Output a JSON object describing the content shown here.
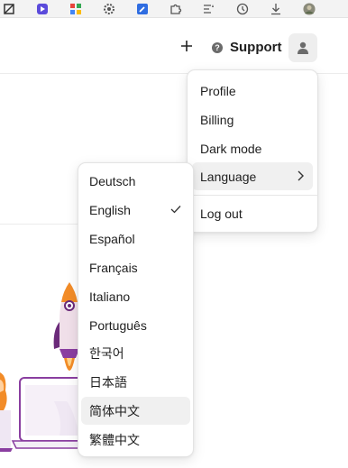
{
  "extensions": [
    {
      "name": "ext-app-icon",
      "color": "#333333"
    },
    {
      "name": "ext-purple-icon",
      "color": "#5b4bdb"
    },
    {
      "name": "ext-tiles-icon",
      "color": "#e8453c"
    },
    {
      "name": "ext-gear-icon",
      "color": "#555555"
    },
    {
      "name": "ext-edit-icon",
      "color": "#2f6de1"
    },
    {
      "name": "ext-puzzle-icon",
      "color": "#555555"
    },
    {
      "name": "ext-favorites-icon",
      "color": "#555555"
    },
    {
      "name": "ext-history-icon",
      "color": "#555555"
    },
    {
      "name": "ext-download-icon",
      "color": "#555555"
    },
    {
      "name": "ext-profile-icon",
      "color": "#777777"
    }
  ],
  "header": {
    "add_icon": "plus-icon",
    "support_label": "Support",
    "support_icon": "question-icon",
    "avatar_icon": "user-icon"
  },
  "user_menu": {
    "items": [
      "Profile",
      "Billing",
      "Dark mode",
      "Language",
      "Log out"
    ],
    "active_item": "Language",
    "submenu_icon": "chevron-right-icon"
  },
  "language_menu": {
    "items": [
      "Deutsch",
      "English",
      "Español",
      "Français",
      "Italiano",
      "Português",
      "한국어",
      "日本語",
      "简体中文",
      "繁體中文"
    ],
    "selected": "English",
    "hovered": "简体中文",
    "selected_icon": "check-icon"
  },
  "colors": {
    "rocket_orange": "#f28c28",
    "rocket_purple": "#6b2a7a",
    "laptop_purple": "#8a3ea0"
  }
}
